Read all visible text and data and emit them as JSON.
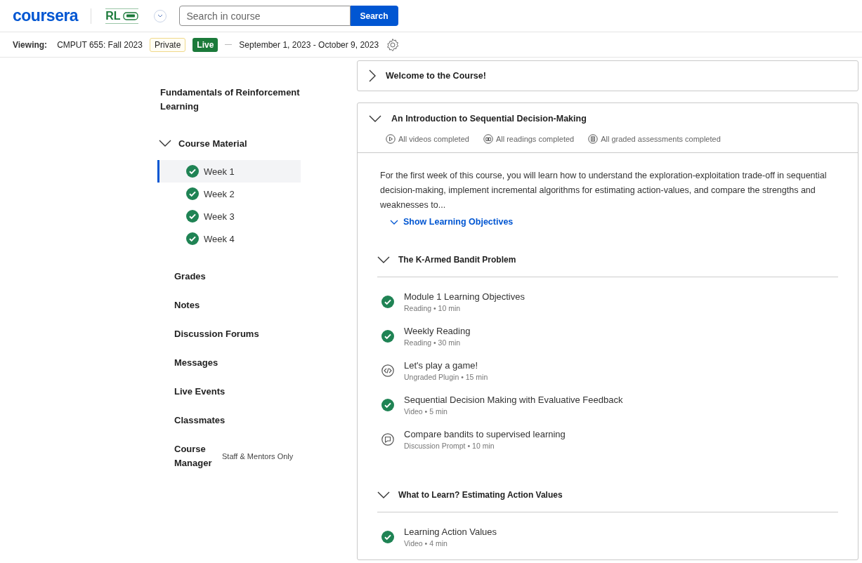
{
  "header": {
    "logo": "coursera",
    "course_logo": "RL",
    "search": {
      "placeholder": "Search in course"
    },
    "search_button": "Search"
  },
  "viewing_bar": {
    "label": "Viewing:",
    "session": "CMPUT 655: Fall 2023",
    "privacy": "Private",
    "status": "Live",
    "dates": "September 1, 2023 - October 9, 2023"
  },
  "sidebar": {
    "course_title": "Fundamentals of Reinforcement Learning",
    "course_material": {
      "label": "Course Material",
      "expanded": true,
      "children": [
        {
          "label": "Week 1",
          "completed": true,
          "selected": true
        },
        {
          "label": "Week 2",
          "completed": true,
          "selected": false
        },
        {
          "label": "Week 3",
          "completed": true,
          "selected": false
        },
        {
          "label": "Week 4",
          "completed": true,
          "selected": false
        }
      ]
    },
    "items": [
      {
        "label": "Grades"
      },
      {
        "label": "Notes"
      },
      {
        "label": "Discussion Forums"
      },
      {
        "label": "Messages"
      },
      {
        "label": "Live Events"
      },
      {
        "label": "Classmates"
      },
      {
        "label": "Course Manager",
        "note": "Staff & Mentors Only"
      }
    ]
  },
  "modules": [
    {
      "title": "Welcome to the Course!",
      "expanded": false
    },
    {
      "title": "An Introduction to Sequential Decision-Making",
      "expanded": true,
      "summaries": [
        {
          "kind": "video",
          "text": "All videos completed"
        },
        {
          "kind": "reading",
          "text": "All readings completed"
        },
        {
          "kind": "assessment",
          "text": "All graded assessments completed"
        }
      ],
      "description": "For the first week of this course, you will learn how to understand the exploration-exploitation trade-off in sequential decision-making, implement incremental algorithms for estimating action-values, and compare the strengths and weaknesses to...",
      "objectives_link": "Show Learning Objectives",
      "lessons": [
        {
          "title": "The K-Armed Bandit Problem",
          "expanded": true,
          "items": [
            {
              "kind": "done",
              "title": "Module 1 Learning Objectives",
              "meta": "Reading • 10 min"
            },
            {
              "kind": "done",
              "title": "Weekly Reading",
              "meta": "Reading • 30 min"
            },
            {
              "kind": "plugin",
              "title": "Let's play a game!",
              "meta": "Ungraded Plugin • 15 min"
            },
            {
              "kind": "done",
              "title": "Sequential Decision Making with Evaluative Feedback",
              "meta": "Video • 5 min"
            },
            {
              "kind": "discussion",
              "title": "Compare bandits to supervised learning",
              "meta": "Discussion Prompt • 10 min"
            }
          ]
        },
        {
          "title": "What to Learn? Estimating Action Values",
          "expanded": true,
          "items": [
            {
              "kind": "done",
              "title": "Learning Action Values",
              "meta": "Video • 4 min"
            }
          ]
        }
      ]
    }
  ]
}
